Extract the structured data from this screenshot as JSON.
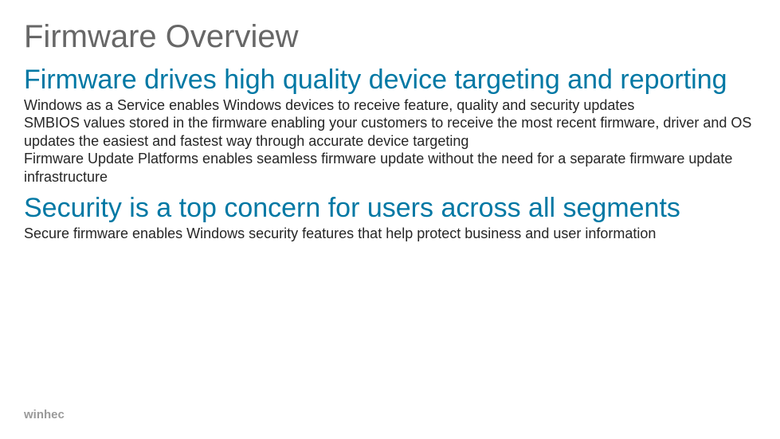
{
  "title": "Firmware Overview",
  "sections": [
    {
      "heading": "Firmware drives high quality device targeting and reporting",
      "paragraphs": [
        "Windows as a Service enables Windows devices to receive feature, quality and security updates",
        "SMBIOS values stored in the firmware enabling your customers to receive the most recent firmware, driver and OS updates the easiest and fastest way through accurate device targeting",
        "Firmware Update Platforms enables seamless firmware update without the need for a separate firmware update infrastructure"
      ]
    },
    {
      "heading": "Security is a top concern for users across all segments",
      "paragraphs": [
        "Secure firmware enables Windows security features that help protect business and user information"
      ]
    }
  ],
  "footer": "winhec"
}
